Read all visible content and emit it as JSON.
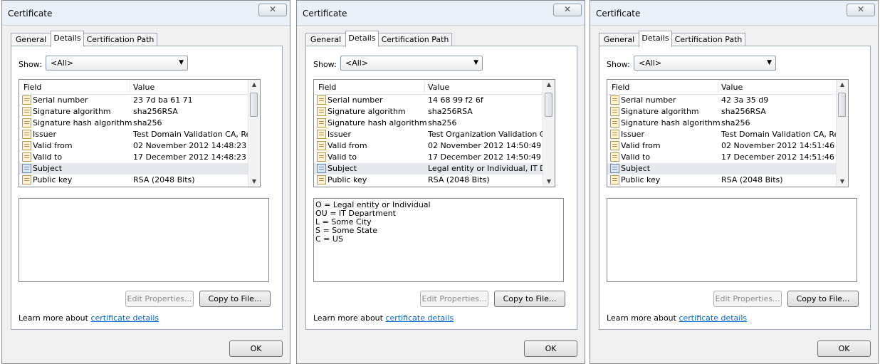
{
  "dialogs": [
    {
      "title": "Certificate",
      "close_glyph": "✕",
      "tabs": [
        "General",
        "Details",
        "Certification Path"
      ],
      "show_label": "Show:",
      "show_value": "<All>",
      "columns": [
        "Field",
        "Value"
      ],
      "rows": [
        {
          "field": "Serial number",
          "value": "23 7d ba 61 71"
        },
        {
          "field": "Signature algorithm",
          "value": "sha256RSA"
        },
        {
          "field": "Signature hash algorithm",
          "value": "sha256"
        },
        {
          "field": "Issuer",
          "value": "Test Domain Validation CA, Re..."
        },
        {
          "field": "Valid from",
          "value": "02 November 2012 14:48:23"
        },
        {
          "field": "Valid to",
          "value": "17 December 2012 14:48:23"
        },
        {
          "field": "Subject",
          "value": ""
        },
        {
          "field": "Public key",
          "value": "RSA (2048 Bits)"
        }
      ],
      "detail_lines": [],
      "edit_properties": "Edit Properties...",
      "copy_to_file": "Copy to File...",
      "learn_more_prefix": "Learn more about",
      "learn_more_link": "certificate details",
      "ok": "OK"
    },
    {
      "title": "Certificate",
      "close_glyph": "✕",
      "tabs": [
        "General",
        "Details",
        "Certification Path"
      ],
      "show_label": "Show:",
      "show_value": "<All>",
      "columns": [
        "Field",
        "Value"
      ],
      "rows": [
        {
          "field": "Serial number",
          "value": "14 68 99 f2 6f"
        },
        {
          "field": "Signature algorithm",
          "value": "sha256RSA"
        },
        {
          "field": "Signature hash algorithm",
          "value": "sha256"
        },
        {
          "field": "Issuer",
          "value": "Test Organization Validation C..."
        },
        {
          "field": "Valid from",
          "value": "02 November 2012 14:50:49"
        },
        {
          "field": "Valid to",
          "value": "17 December 2012 14:50:49"
        },
        {
          "field": "Subject",
          "value": "Legal entity or Individual, IT D..."
        },
        {
          "field": "Public key",
          "value": "RSA (2048 Bits)"
        }
      ],
      "detail_lines": [
        "O = Legal entity or Individual",
        "OU = IT Department",
        "L = Some City",
        "S = Some State",
        "C = US"
      ],
      "edit_properties": "Edit Properties...",
      "copy_to_file": "Copy to File...",
      "learn_more_prefix": "Learn more about",
      "learn_more_link": "certificate details",
      "ok": "OK"
    },
    {
      "title": "Certificate",
      "close_glyph": "✕",
      "tabs": [
        "General",
        "Details",
        "Certification Path"
      ],
      "show_label": "Show:",
      "show_value": "<All>",
      "columns": [
        "Field",
        "Value"
      ],
      "rows": [
        {
          "field": "Serial number",
          "value": "42 3a 35 d9"
        },
        {
          "field": "Signature algorithm",
          "value": "sha256RSA"
        },
        {
          "field": "Signature hash algorithm",
          "value": "sha256"
        },
        {
          "field": "Issuer",
          "value": "Test Domain Validation CA, Re..."
        },
        {
          "field": "Valid from",
          "value": "02 November 2012 14:51:46"
        },
        {
          "field": "Valid to",
          "value": "17 December 2012 14:51:46"
        },
        {
          "field": "Subject",
          "value": ""
        },
        {
          "field": "Public key",
          "value": "RSA (2048 Bits)"
        }
      ],
      "detail_lines": [],
      "edit_properties": "Edit Properties...",
      "copy_to_file": "Copy to File...",
      "learn_more_prefix": "Learn more about",
      "learn_more_link": "certificate details",
      "ok": "OK"
    }
  ]
}
